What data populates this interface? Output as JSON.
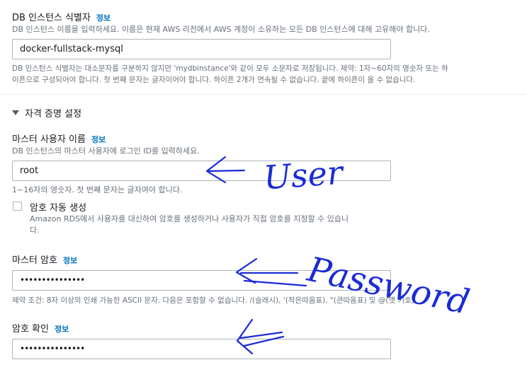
{
  "db_identifier": {
    "label": "DB 인스턴스 식별자",
    "info": "정보",
    "description": "DB 인스턴스 이름을 입력하세요. 이름은 현재 AWS 리전에서 AWS 계정이 소유하는 모든 DB 인스턴스에 대해 고유해야 합니다.",
    "value": "docker-fullstack-mysql",
    "constraint_line1": "DB 인스턴스 식별자는 대소문자를 구분하지 않지만 'mydbinstance'와 같이 모두 소문자로 저장됩니다. 제약: 1자~60자의 영숫자 또는 하",
    "constraint_line2": "이픈으로 구성되어야 합니다. 첫 번째 문자는 글자이어야 합니다. 하이픈 2개가 연속될 수 없습니다. 끝에 하이픈이 올 수 없습니다."
  },
  "credentials_section": {
    "title": "자격 증명 설정"
  },
  "master_username": {
    "label": "마스터 사용자 이름",
    "info": "정보",
    "description": "DB 인스턴스의 마스터 사용자에 로그인 ID를 입력하세요.",
    "value": "root",
    "constraint": "1~16자의 영숫자. 첫 번째 문자는 글자여야 합니다."
  },
  "auto_password": {
    "label": "암호 자동 생성",
    "description_line1": "Amazon RDS에서 사용자를 대신하여 암호를 생성하거나 사용자가 직접 암호를 지정할 수 있습니",
    "description_line2": "다."
  },
  "master_password": {
    "label": "마스터 암호",
    "info": "정보",
    "value": "•••••••••••••••",
    "constraint": "제약 조건: 8자 이상의 인쇄 가능한 ASCII 문자. 다음은 포함할 수 없습니다. /(슬래시), '(작은따옴표), \"(큰따옴표) 및 @(앳 기호)."
  },
  "confirm_password": {
    "label": "암호 확인",
    "info": "정보",
    "value": "•••••••••••••••"
  },
  "annotations": {
    "user": "User",
    "password": "Password",
    "ink_color": "#1a2bd6"
  }
}
